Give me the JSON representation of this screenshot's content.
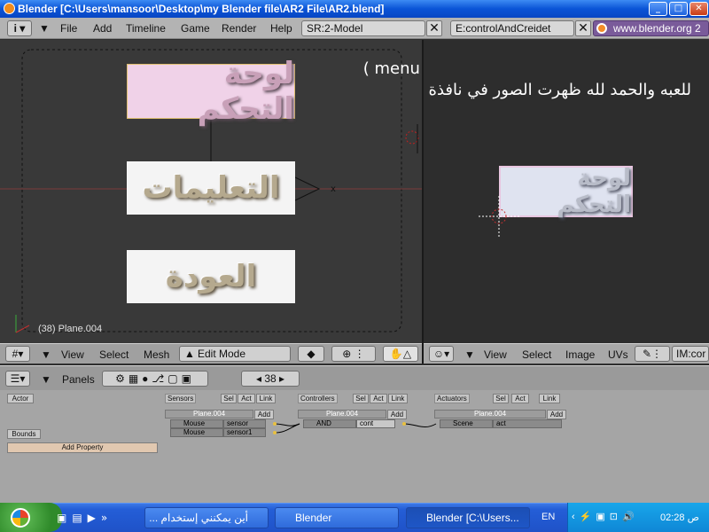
{
  "window": {
    "title": "Blender [C:\\Users\\mansoor\\Desktop\\my Blender file\\AR2 File\\AR2.blend]"
  },
  "topbar": {
    "menus": [
      "File",
      "Add",
      "Timeline",
      "Game",
      "Render",
      "Help"
    ],
    "scene_screen": "SR:2-Model",
    "scene_name": "E:controlAndCreidet",
    "website": "www.blender.org 2"
  },
  "viewport": {
    "object_label": "(38) Plane.004",
    "planes": {
      "control": "لوحة التحكم",
      "instructions": "التعليمات",
      "back": "العودة"
    },
    "note_line1": "هذا مثال لتطبيق الدرس في عمل قائمة ( menu )",
    "note_line2": "للعبه والحمد لله ظهرت الصور في نافذة الـ Menu"
  },
  "imageview": {
    "preview_text": "لوحة التحكم"
  },
  "view3d_header": {
    "menus": [
      "View",
      "Select",
      "Mesh"
    ],
    "mode": "Edit Mode"
  },
  "image_header": {
    "menus": [
      "View",
      "Select",
      "Image",
      "UVs"
    ],
    "image_name": "IM:cor"
  },
  "buttons_header": {
    "panels_label": "Panels",
    "frame": "38"
  },
  "logic": {
    "actor_label": "Actor",
    "bounds_label": "Bounds",
    "add_property_label": "Add Property",
    "sensors_title": "Sensors",
    "controllers_title": "Controllers",
    "actuators_title": "Actuators",
    "sel_label": "Sel",
    "act_label": "Act",
    "link_label": "Link",
    "object_name": "Plane.004",
    "add_label": "Add",
    "sensors": [
      {
        "type": "Mouse",
        "name": "sensor"
      },
      {
        "type": "Mouse",
        "name": "sensor1"
      }
    ],
    "controller": {
      "type": "AND",
      "name": "cont"
    },
    "actuator": {
      "type": "Scene",
      "name": "act"
    }
  },
  "taskbar": {
    "tasks": [
      "أين يمكنني إستخدام ...",
      "Blender",
      "Blender [C:\\Users..."
    ],
    "lang": "EN",
    "clock": "ص 02:28"
  },
  "colors": {
    "xp_blue": "#0a54d6",
    "blender_header": "#b3b3b3",
    "viewport_bg": "#393939",
    "selected_plane": "#f0d2e8"
  }
}
